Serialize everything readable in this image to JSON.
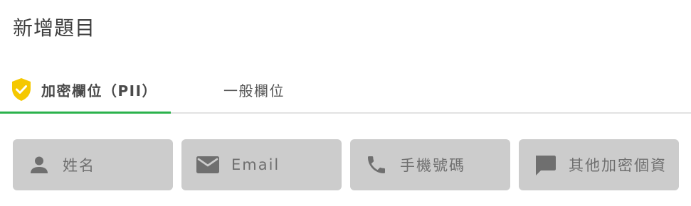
{
  "page": {
    "title": "新增題目"
  },
  "tabs": [
    {
      "label": "加密欄位（PII）",
      "icon": "shield-check-icon",
      "active": true
    },
    {
      "label": "一般欄位",
      "active": false
    }
  ],
  "fields": [
    {
      "label": "姓名",
      "icon": "person-icon"
    },
    {
      "label": "Email",
      "icon": "envelope-icon"
    },
    {
      "label": "手機號碼",
      "icon": "phone-icon"
    },
    {
      "label": "其他加密個資",
      "icon": "chat-bubble-icon"
    }
  ],
  "colors": {
    "active_tab_underline": "#2bb24c",
    "shield": "#f5c800",
    "field_bg": "#cccccc",
    "field_text": "#6f6f6f"
  }
}
